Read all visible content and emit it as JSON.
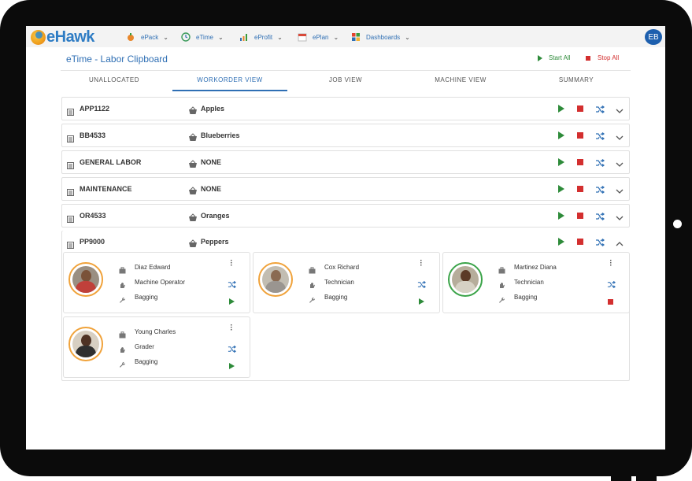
{
  "app": {
    "logo_text": "eHawk",
    "user_initials": "EB"
  },
  "nav": [
    {
      "label": "ePack",
      "icon": "pack-icon"
    },
    {
      "label": "eTime",
      "icon": "clock-icon"
    },
    {
      "label": "eProfit",
      "icon": "chart-icon"
    },
    {
      "label": "ePlan",
      "icon": "calendar-icon"
    },
    {
      "label": "Dashboards",
      "icon": "dashboard-icon"
    }
  ],
  "page": {
    "title": "eTime - Labor Clipboard",
    "start_all": "Start All",
    "stop_all": "Stop All"
  },
  "tabs": [
    {
      "label": "UNALLOCATED"
    },
    {
      "label": "WORKORDER VIEW",
      "active": true
    },
    {
      "label": "JOB VIEW"
    },
    {
      "label": "MACHINE VIEW"
    },
    {
      "label": "SUMMARY"
    }
  ],
  "workorders": [
    {
      "code": "APP1122",
      "product": "Apples",
      "expanded": false
    },
    {
      "code": "BB4533",
      "product": "Blueberries",
      "expanded": false
    },
    {
      "code": "GENERAL LABOR",
      "product": "NONE",
      "expanded": false
    },
    {
      "code": "MAINTENANCE",
      "product": "NONE",
      "expanded": false
    },
    {
      "code": "OR4533",
      "product": "Oranges",
      "expanded": false
    },
    {
      "code": "PP9000",
      "product": "Peppers",
      "expanded": true
    }
  ],
  "workers": [
    {
      "name": "Diaz Edward",
      "role": "Machine Operator",
      "task": "Bagging",
      "status": "stopped"
    },
    {
      "name": "Cox Richard",
      "role": "Technician",
      "task": "Bagging",
      "status": "stopped"
    },
    {
      "name": "Martinez Diana",
      "role": "Technician",
      "task": "Bagging",
      "status": "running"
    },
    {
      "name": "Young Charles",
      "role": "Grader",
      "task": "Bagging",
      "status": "stopped"
    }
  ],
  "colors": {
    "accent": "#2f6fb4",
    "start": "#2e8b3a",
    "stop": "#d32f2f",
    "photo_ring_idle": "#f0a23a",
    "photo_ring_active": "#3aa348"
  }
}
